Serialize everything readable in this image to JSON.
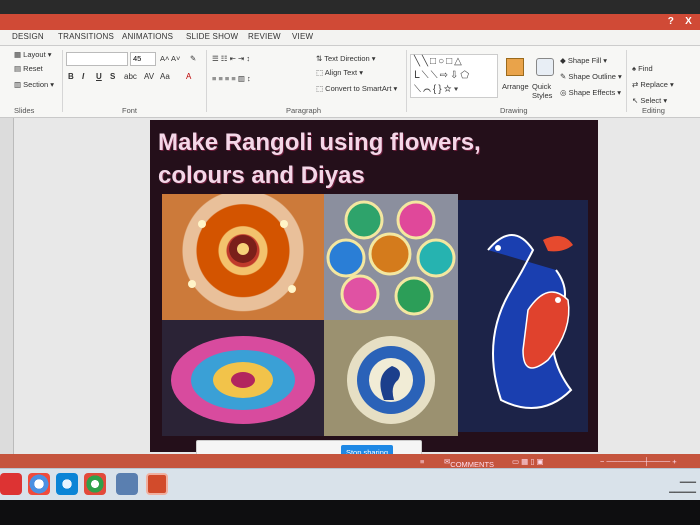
{
  "ribbon_tabs": [
    "DESIGN",
    "TRANSITIONS",
    "ANIMATIONS",
    "SLIDE SHOW",
    "REVIEW",
    "VIEW"
  ],
  "window": {
    "help": "?",
    "close": "X"
  },
  "slides_group": {
    "layout": "Layout",
    "reset": "Reset",
    "section": "Section",
    "label": "Slides"
  },
  "font_group": {
    "size": "45",
    "bold": "B",
    "italic": "I",
    "underline": "U",
    "strike": "S",
    "case": "Aa",
    "label": "Font"
  },
  "paragraph_group": {
    "text_direction": "Text Direction",
    "align_text": "Align Text",
    "convert_smartart": "Convert to SmartArt",
    "label": "Paragraph"
  },
  "drawing_group": {
    "arrange": "Arrange",
    "quick_styles": "Quick Styles",
    "shape_fill": "Shape Fill",
    "shape_outline": "Shape Outline",
    "shape_effects": "Shape Effects",
    "label": "Drawing"
  },
  "editing_group": {
    "find": "Find",
    "replace": "Replace",
    "select": "Select",
    "label": "Editing"
  },
  "slide": {
    "title": "Make Rangoli using flowers, colours and Diyas"
  },
  "notification": {
    "button": "Stop sharing"
  },
  "statusbar": {
    "comments": "COMMENTS"
  },
  "colors": {
    "titlebar": "#d04a36",
    "slide_bg": "#240f1a",
    "slide_title": "#f4d7e8",
    "share_button": "#1e88e5"
  }
}
